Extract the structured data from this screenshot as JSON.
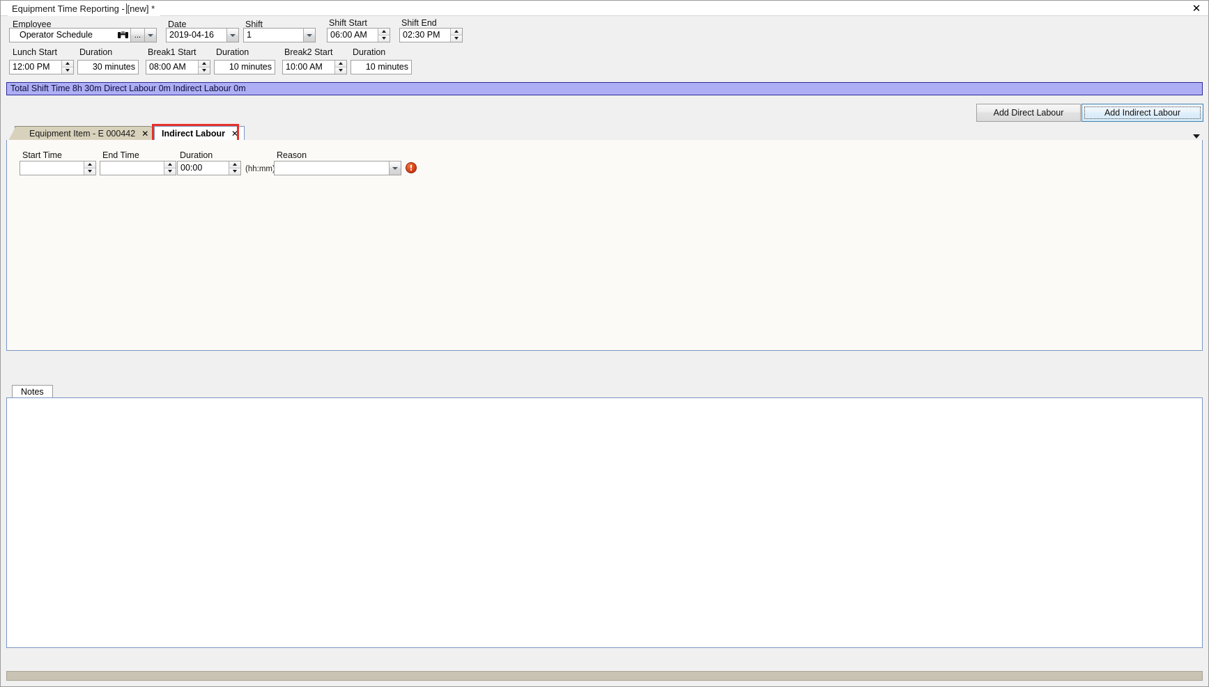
{
  "window": {
    "title": "Equipment Time Reporting - [new] *",
    "close_label": "✕"
  },
  "header_form": {
    "fields": [
      {
        "label": "Employee",
        "value": "Operator Schedule"
      },
      {
        "label": "Date",
        "value": "2019-04-16"
      },
      {
        "label": "Shift",
        "value": "1"
      },
      {
        "label": "Shift Start",
        "value": "06:00 AM"
      },
      {
        "label": "Shift End",
        "value": "02:30 PM"
      },
      {
        "label": "Lunch Start",
        "value": "12:00 PM"
      },
      {
        "label": "Duration",
        "value": "30 minutes"
      },
      {
        "label": "Break1 Start",
        "value": "08:00 AM"
      },
      {
        "label": "Duration",
        "value": "10 minutes"
      },
      {
        "label": "Break2 Start",
        "value": "10:00 AM"
      },
      {
        "label": "Duration",
        "value": "10 minutes"
      }
    ],
    "employee_lookup_icon": "binoculars-icon",
    "employee_browse_label": "..."
  },
  "summary": {
    "text": "Total Shift Time 8h 30m  Direct Labour 0m  Indirect Labour 0m"
  },
  "actions": {
    "add_direct_label": "Add Direct Labour",
    "add_indirect_label": "Add Indirect Labour"
  },
  "tabs": {
    "items": [
      {
        "label": "Equipment Item - E 000442",
        "close": "✕",
        "active": false
      },
      {
        "label": "Indirect Labour",
        "close": "✕",
        "active": true
      }
    ],
    "highlight_color": "#e8312a"
  },
  "indirect_form": {
    "start_time": {
      "label": "Start Time",
      "value": ""
    },
    "end_time": {
      "label": "End Time",
      "value": ""
    },
    "duration": {
      "label": "Duration",
      "value": "00:00",
      "hint": "(hh:mm)"
    },
    "reason": {
      "label": "Reason",
      "value": ""
    },
    "error_icon": "error-exclamation-icon"
  },
  "notes": {
    "tab_label": "Notes",
    "value": ""
  }
}
